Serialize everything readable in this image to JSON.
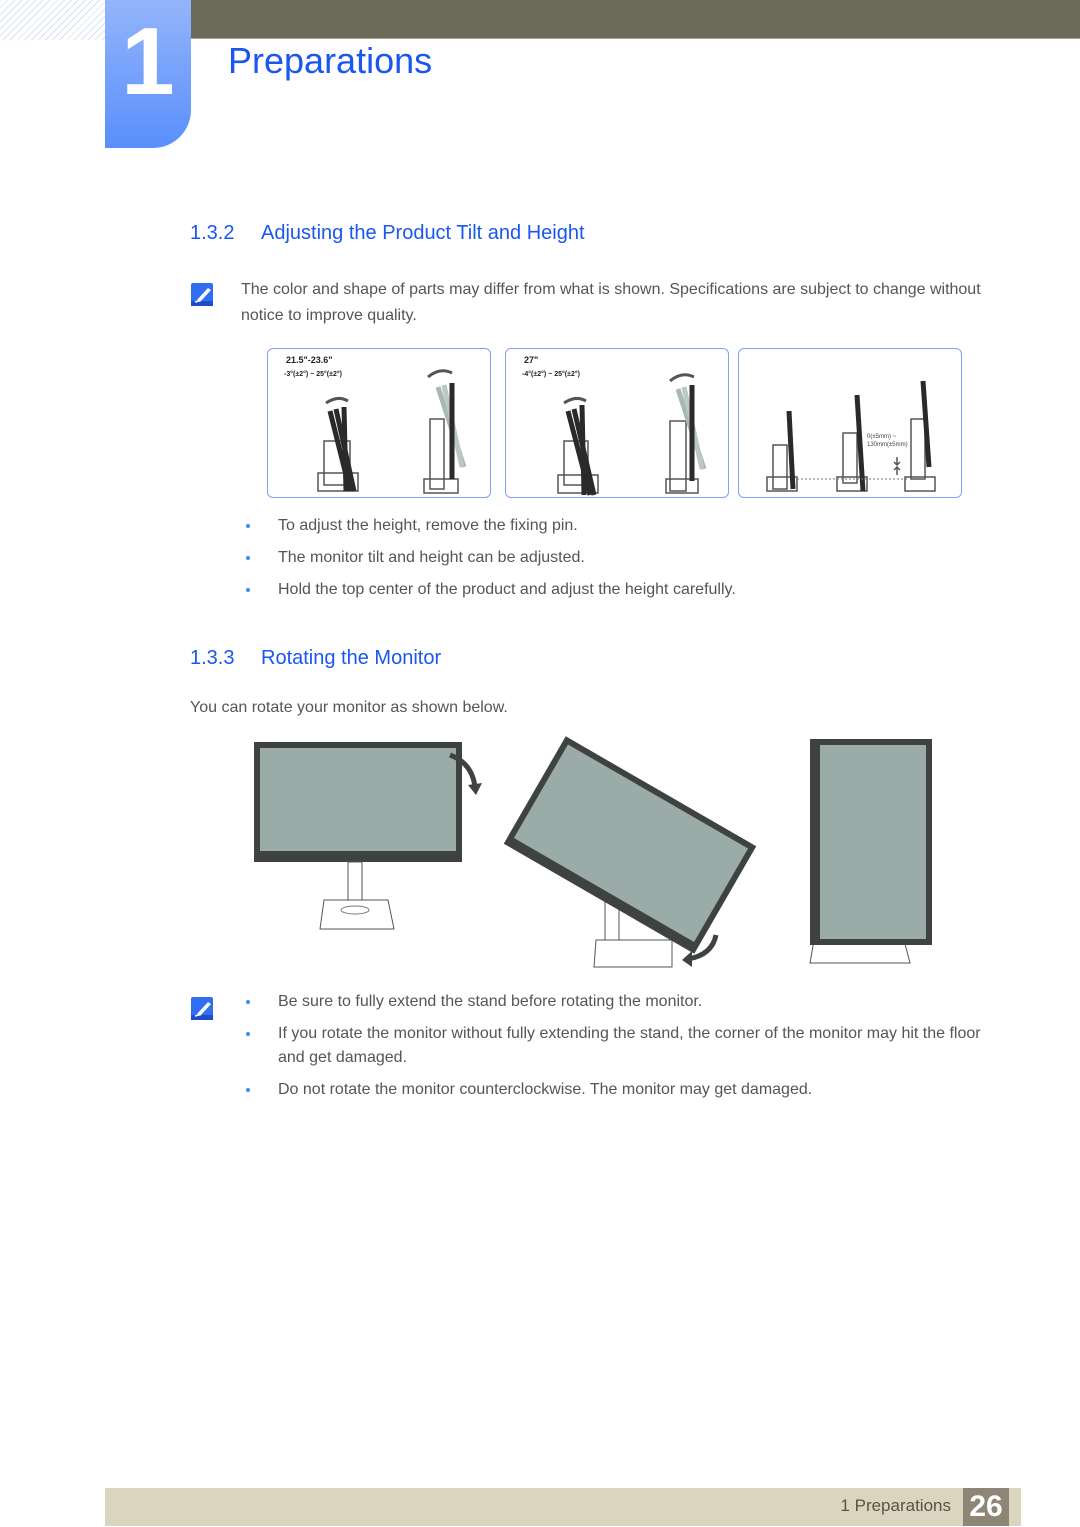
{
  "header": {
    "chapter_number": "1",
    "chapter_title": "Preparations"
  },
  "section_tilt": {
    "number": "1.3.2",
    "title": "Adjusting the Product Tilt and Height",
    "note": "The color and shape of parts may differ from what is shown. Specifications are subject to change without notice to improve quality.",
    "panels": [
      {
        "size": "21.5\"-23.6\"",
        "angle": "-3°(±2°) ~ 25°(±2°)"
      },
      {
        "size": "27\"",
        "angle": "-4°(±2°) ~ 25°(±2°)"
      },
      {
        "height_range_line1": "0(±5mm) ~",
        "height_range_line2": "130mm(±5mm)"
      }
    ],
    "bullets": [
      "To adjust the height, remove the fixing pin.",
      "The monitor tilt and height can be adjusted.",
      "Hold the top center of the product and adjust the height carefully."
    ]
  },
  "section_rotate": {
    "number": "1.3.3",
    "title": "Rotating the Monitor",
    "intro": "You can rotate your monitor as shown below.",
    "notes": [
      "Be sure to fully extend the stand before rotating the monitor.",
      "If you rotate the monitor without fully extending the stand, the corner of the monitor may hit the floor and get damaged.",
      "Do not rotate the monitor counterclockwise. The monitor may get damaged."
    ]
  },
  "footer": {
    "label": "1 Preparations",
    "page": "26"
  },
  "colors": {
    "accent": "#1a56f0",
    "bullet": "#3e8ee8",
    "topbar": "#6c6a58",
    "footer": "#dbd5c0",
    "page_badge": "#8f8576",
    "screen": "#9aaba8",
    "bezel": "#3e4342"
  }
}
